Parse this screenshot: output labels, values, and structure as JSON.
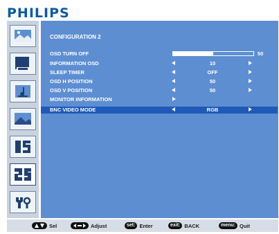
{
  "brand": "PHILIPS",
  "colors": {
    "brand": "#0b5ba6",
    "panel": "#5d8ed2",
    "highlight": "#1f5ab8",
    "sidebar": "#c9d3df",
    "footer": "#d7dde6"
  },
  "sidebar": {
    "items": [
      {
        "icon": "picture-icon"
      },
      {
        "icon": "screen-icon"
      },
      {
        "icon": "audio-icon"
      },
      {
        "icon": "landscape-icon"
      },
      {
        "icon": "configuration-1-icon"
      },
      {
        "icon": "configuration-2-icon",
        "active": true
      },
      {
        "icon": "advanced-option-icon"
      }
    ]
  },
  "menu": {
    "title": "CONFIGURATION 2",
    "osd_turn_off": {
      "label": "OSD TURN OFF",
      "value": "50",
      "level": 0.5
    },
    "information_osd": {
      "label": "INFORMATION OSD",
      "value": "10"
    },
    "sleep_timer": {
      "label": "SLEEP TIMER",
      "value": "OFF"
    },
    "osd_h_position": {
      "label": "OSD H POSITION",
      "value": "50"
    },
    "osd_v_position": {
      "label": "OSD V POSITION",
      "value": "50"
    },
    "monitor_information": {
      "label": "MONITOR INFORMATION"
    },
    "bnc_video_mode": {
      "label": "BNC VIDEO MODE",
      "value": "RGB"
    }
  },
  "footer": {
    "sel": "Sel",
    "adjust": "Adjust",
    "enter_key": "set:",
    "enter": "Enter",
    "back_key": "exit:",
    "back": "BACK",
    "quit_key": "menu:",
    "quit": "Quit"
  }
}
